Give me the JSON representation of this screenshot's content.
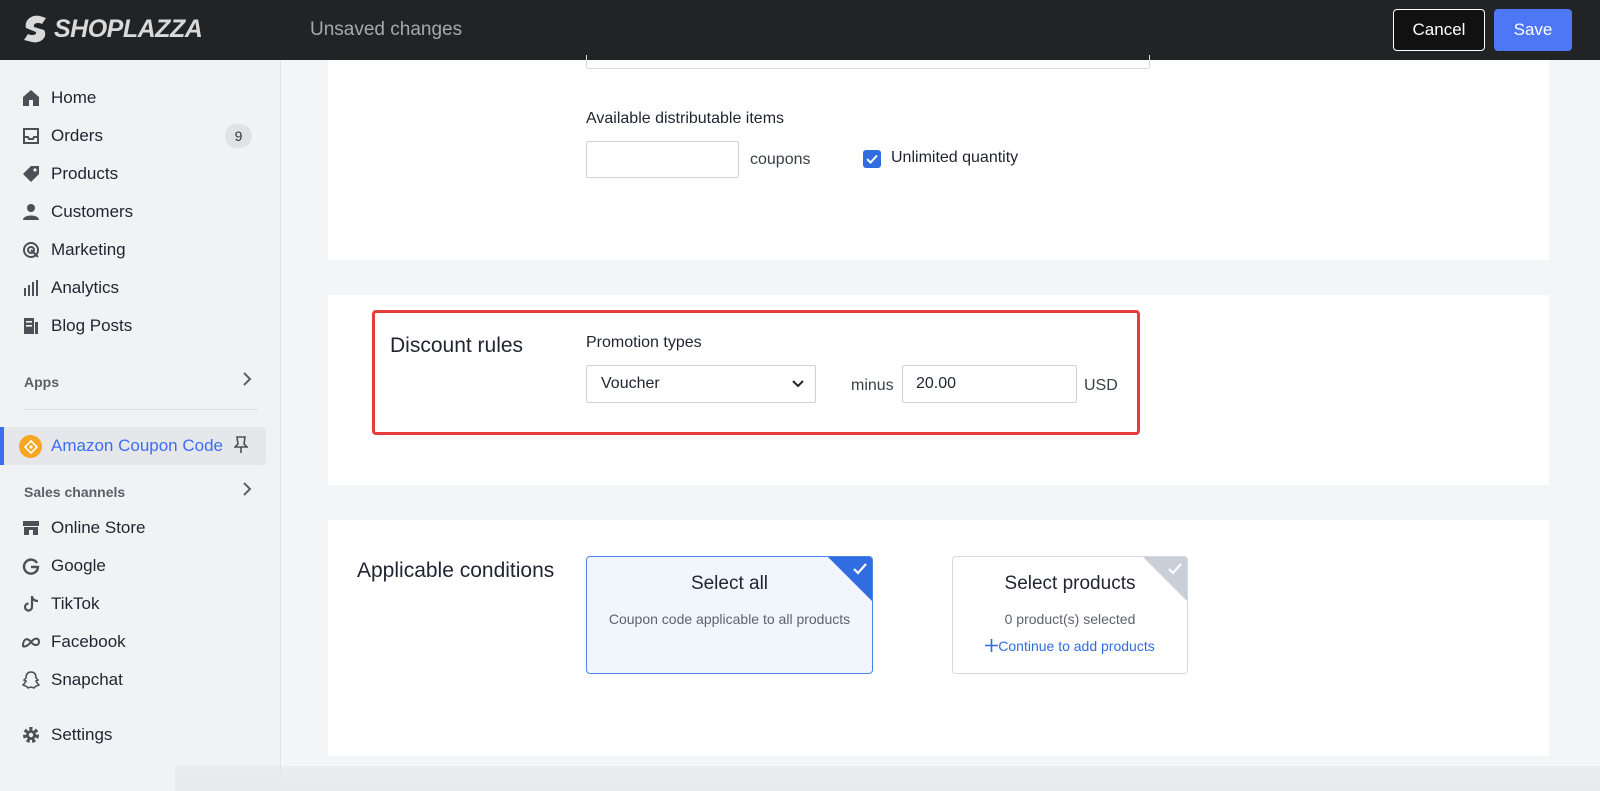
{
  "header": {
    "brand": "SHOPLAZZA",
    "status": "Unsaved changes",
    "cancel_label": "Cancel",
    "save_label": "Save",
    "save_color": "#4d77f5"
  },
  "sidebar": {
    "items": [
      {
        "label": "Home",
        "icon": "home-icon"
      },
      {
        "label": "Orders",
        "icon": "inbox-icon",
        "badge": "9"
      },
      {
        "label": "Products",
        "icon": "tag-icon"
      },
      {
        "label": "Customers",
        "icon": "person-icon"
      },
      {
        "label": "Marketing",
        "icon": "target-icon"
      },
      {
        "label": "Analytics",
        "icon": "bar-chart-icon"
      },
      {
        "label": "Blog Posts",
        "icon": "document-icon"
      }
    ],
    "apps_label": "Apps",
    "active_app": {
      "label": "Amazon Coupon Code",
      "icon": "coupon-icon"
    },
    "sales_channels_label": "Sales channels",
    "channels": [
      {
        "label": "Online Store",
        "icon": "store-icon"
      },
      {
        "label": "Google",
        "icon": "google-icon"
      },
      {
        "label": "TikTok",
        "icon": "tiktok-icon"
      },
      {
        "label": "Facebook",
        "icon": "meta-icon"
      },
      {
        "label": "Snapchat",
        "icon": "ghost-icon"
      }
    ],
    "settings_label": "Settings"
  },
  "distribution": {
    "label": "Available distributable items",
    "quantity_value": "",
    "unit": "coupons",
    "unlimited_label": "Unlimited quantity",
    "unlimited_checked": true
  },
  "discount_rules": {
    "title": "Discount rules",
    "promotion_label": "Promotion types",
    "promotion_value": "Voucher",
    "minus_label": "minus",
    "amount_value": "20.00",
    "currency": "USD"
  },
  "conditions": {
    "title": "Applicable conditions",
    "options": [
      {
        "title": "Select all",
        "subtitle": "Coupon code applicable to all products",
        "selected": true
      },
      {
        "title": "Select products",
        "subtitle": "0 product(s) selected",
        "link": "Continue to add products",
        "selected": false
      }
    ]
  }
}
